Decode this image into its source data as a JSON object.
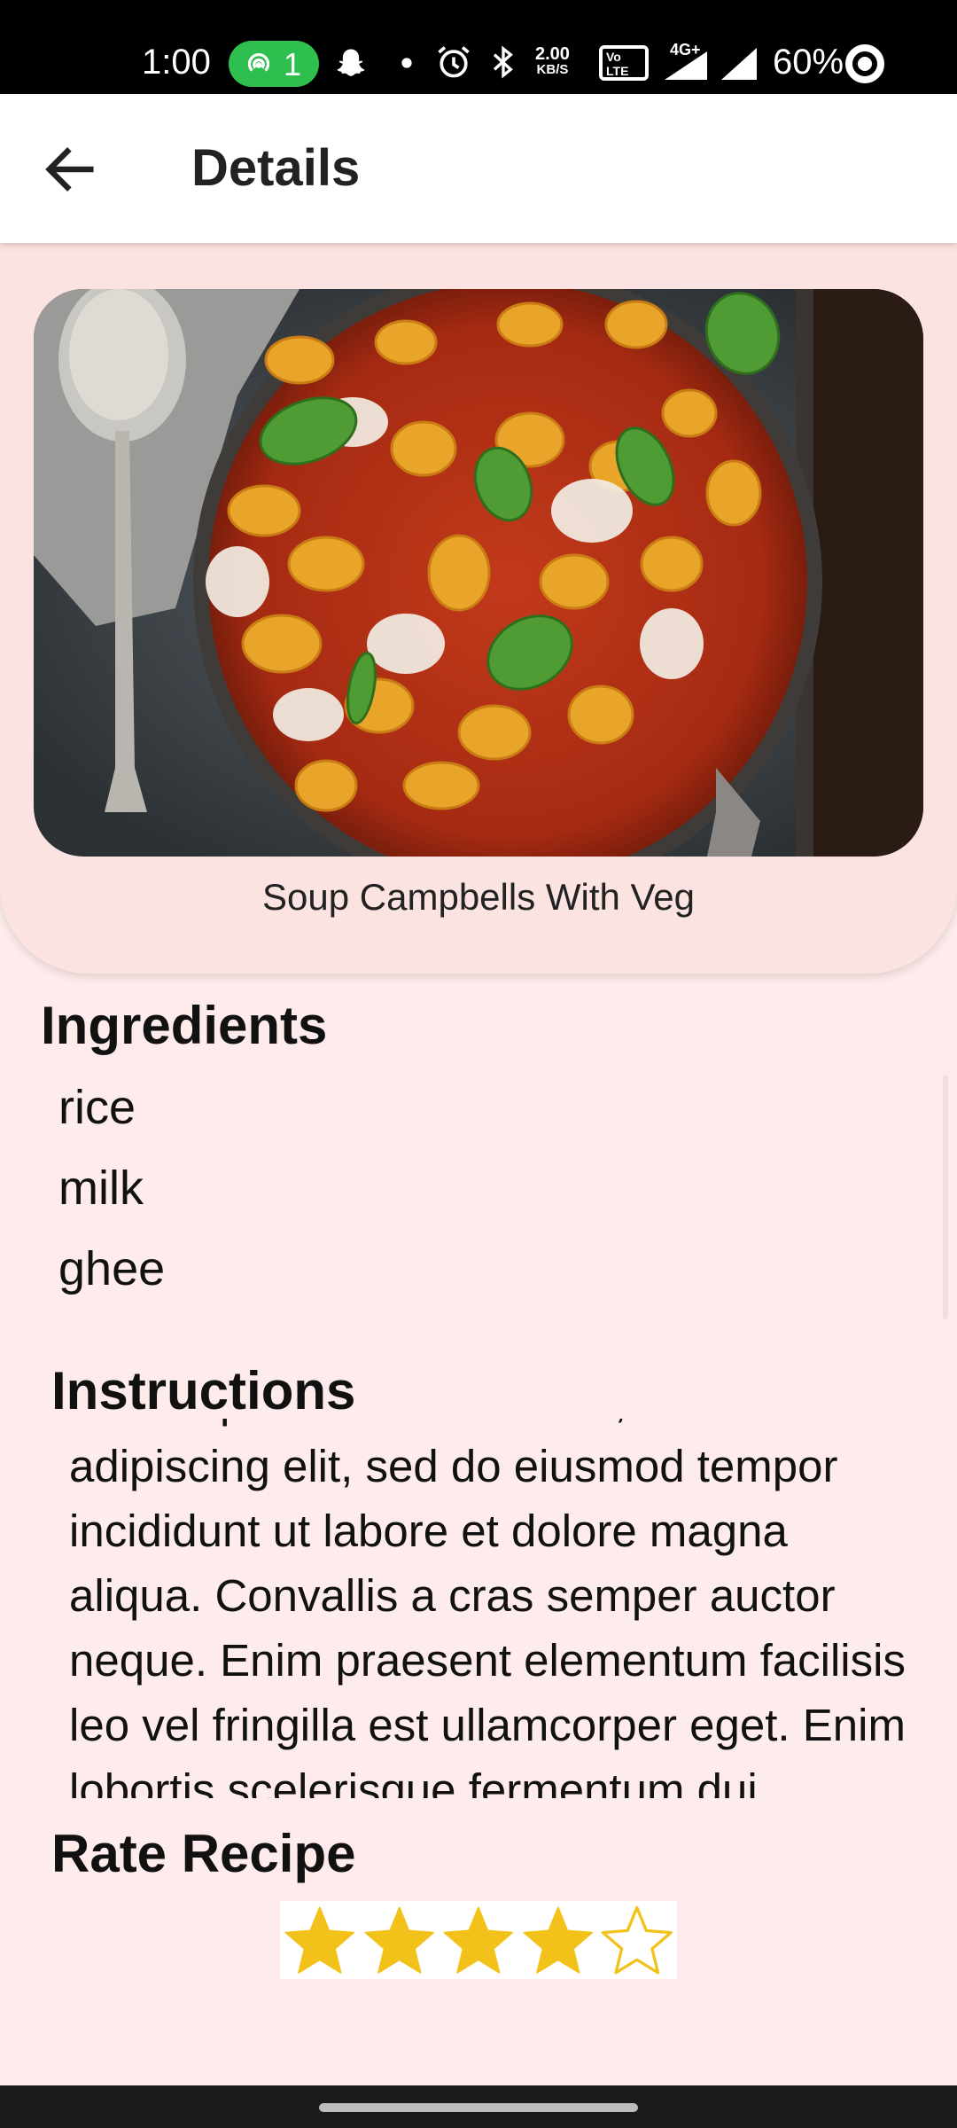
{
  "status_bar": {
    "time": "1:00",
    "hotspot_count": "1",
    "speed_value": "2.00",
    "speed_unit": "KB/S",
    "network": "4G+",
    "battery": "60%",
    "icons": [
      "hotspot-icon",
      "snapchat-icon",
      "dot-icon",
      "alarm-icon",
      "bluetooth-icon",
      "volte-icon",
      "signal-icon",
      "wifi-signal-icon",
      "battery-icon"
    ]
  },
  "app_bar": {
    "title": "Details",
    "back_icon": "arrow-left-icon"
  },
  "recipe": {
    "image": "gnocchi-tomato-basil-dish",
    "name": "Soup Campbells  With Veg"
  },
  "ingredients": {
    "title": "Ingredients",
    "items": [
      "rice",
      "milk",
      "ghee"
    ]
  },
  "instructions": {
    "title": "Instructions",
    "text": "Lorem ipsum dolor sit amet, consectetur adipiscing elit, sed do eiusmod tempor incididunt ut labore et dolore magna aliqua. Convallis a cras semper auctor neque. Enim praesent elementum facilisis leo vel fringilla est ullamcorper eget. Enim lobortis scelerisque fermentum dui faucibus. Odio euismod lacinia at quis risus sed"
  },
  "rating": {
    "title": "Rate Recipe",
    "value": 4,
    "max": 5,
    "filled_color": "#f2c21a",
    "empty_color": "#f2c21a"
  },
  "colors": {
    "background": "#fdeceb",
    "card": "#fbe3e1",
    "hotspot_badge": "#2fbf4e"
  }
}
